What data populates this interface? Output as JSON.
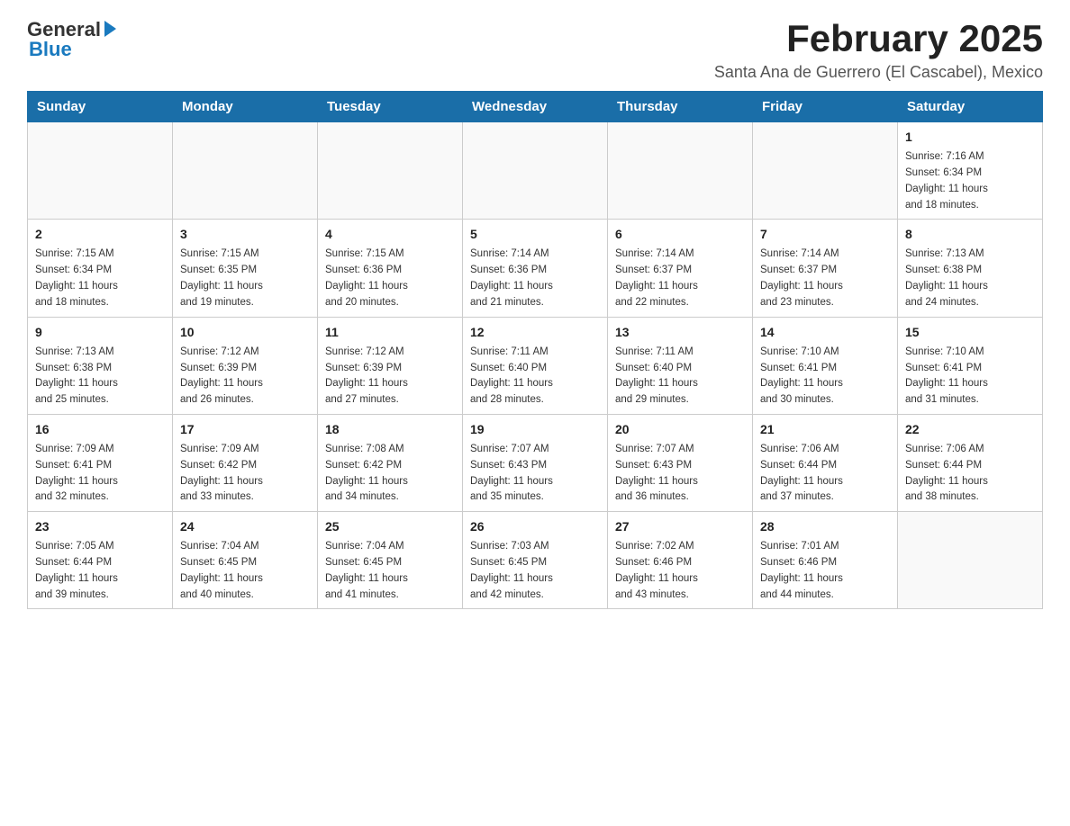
{
  "logo": {
    "general": "General",
    "blue": "Blue"
  },
  "title": "February 2025",
  "subtitle": "Santa Ana de Guerrero (El Cascabel), Mexico",
  "weekdays": [
    "Sunday",
    "Monday",
    "Tuesday",
    "Wednesday",
    "Thursday",
    "Friday",
    "Saturday"
  ],
  "weeks": [
    [
      {
        "day": "",
        "info": ""
      },
      {
        "day": "",
        "info": ""
      },
      {
        "day": "",
        "info": ""
      },
      {
        "day": "",
        "info": ""
      },
      {
        "day": "",
        "info": ""
      },
      {
        "day": "",
        "info": ""
      },
      {
        "day": "1",
        "info": "Sunrise: 7:16 AM\nSunset: 6:34 PM\nDaylight: 11 hours\nand 18 minutes."
      }
    ],
    [
      {
        "day": "2",
        "info": "Sunrise: 7:15 AM\nSunset: 6:34 PM\nDaylight: 11 hours\nand 18 minutes."
      },
      {
        "day": "3",
        "info": "Sunrise: 7:15 AM\nSunset: 6:35 PM\nDaylight: 11 hours\nand 19 minutes."
      },
      {
        "day": "4",
        "info": "Sunrise: 7:15 AM\nSunset: 6:36 PM\nDaylight: 11 hours\nand 20 minutes."
      },
      {
        "day": "5",
        "info": "Sunrise: 7:14 AM\nSunset: 6:36 PM\nDaylight: 11 hours\nand 21 minutes."
      },
      {
        "day": "6",
        "info": "Sunrise: 7:14 AM\nSunset: 6:37 PM\nDaylight: 11 hours\nand 22 minutes."
      },
      {
        "day": "7",
        "info": "Sunrise: 7:14 AM\nSunset: 6:37 PM\nDaylight: 11 hours\nand 23 minutes."
      },
      {
        "day": "8",
        "info": "Sunrise: 7:13 AM\nSunset: 6:38 PM\nDaylight: 11 hours\nand 24 minutes."
      }
    ],
    [
      {
        "day": "9",
        "info": "Sunrise: 7:13 AM\nSunset: 6:38 PM\nDaylight: 11 hours\nand 25 minutes."
      },
      {
        "day": "10",
        "info": "Sunrise: 7:12 AM\nSunset: 6:39 PM\nDaylight: 11 hours\nand 26 minutes."
      },
      {
        "day": "11",
        "info": "Sunrise: 7:12 AM\nSunset: 6:39 PM\nDaylight: 11 hours\nand 27 minutes."
      },
      {
        "day": "12",
        "info": "Sunrise: 7:11 AM\nSunset: 6:40 PM\nDaylight: 11 hours\nand 28 minutes."
      },
      {
        "day": "13",
        "info": "Sunrise: 7:11 AM\nSunset: 6:40 PM\nDaylight: 11 hours\nand 29 minutes."
      },
      {
        "day": "14",
        "info": "Sunrise: 7:10 AM\nSunset: 6:41 PM\nDaylight: 11 hours\nand 30 minutes."
      },
      {
        "day": "15",
        "info": "Sunrise: 7:10 AM\nSunset: 6:41 PM\nDaylight: 11 hours\nand 31 minutes."
      }
    ],
    [
      {
        "day": "16",
        "info": "Sunrise: 7:09 AM\nSunset: 6:41 PM\nDaylight: 11 hours\nand 32 minutes."
      },
      {
        "day": "17",
        "info": "Sunrise: 7:09 AM\nSunset: 6:42 PM\nDaylight: 11 hours\nand 33 minutes."
      },
      {
        "day": "18",
        "info": "Sunrise: 7:08 AM\nSunset: 6:42 PM\nDaylight: 11 hours\nand 34 minutes."
      },
      {
        "day": "19",
        "info": "Sunrise: 7:07 AM\nSunset: 6:43 PM\nDaylight: 11 hours\nand 35 minutes."
      },
      {
        "day": "20",
        "info": "Sunrise: 7:07 AM\nSunset: 6:43 PM\nDaylight: 11 hours\nand 36 minutes."
      },
      {
        "day": "21",
        "info": "Sunrise: 7:06 AM\nSunset: 6:44 PM\nDaylight: 11 hours\nand 37 minutes."
      },
      {
        "day": "22",
        "info": "Sunrise: 7:06 AM\nSunset: 6:44 PM\nDaylight: 11 hours\nand 38 minutes."
      }
    ],
    [
      {
        "day": "23",
        "info": "Sunrise: 7:05 AM\nSunset: 6:44 PM\nDaylight: 11 hours\nand 39 minutes."
      },
      {
        "day": "24",
        "info": "Sunrise: 7:04 AM\nSunset: 6:45 PM\nDaylight: 11 hours\nand 40 minutes."
      },
      {
        "day": "25",
        "info": "Sunrise: 7:04 AM\nSunset: 6:45 PM\nDaylight: 11 hours\nand 41 minutes."
      },
      {
        "day": "26",
        "info": "Sunrise: 7:03 AM\nSunset: 6:45 PM\nDaylight: 11 hours\nand 42 minutes."
      },
      {
        "day": "27",
        "info": "Sunrise: 7:02 AM\nSunset: 6:46 PM\nDaylight: 11 hours\nand 43 minutes."
      },
      {
        "day": "28",
        "info": "Sunrise: 7:01 AM\nSunset: 6:46 PM\nDaylight: 11 hours\nand 44 minutes."
      },
      {
        "day": "",
        "info": ""
      }
    ]
  ]
}
